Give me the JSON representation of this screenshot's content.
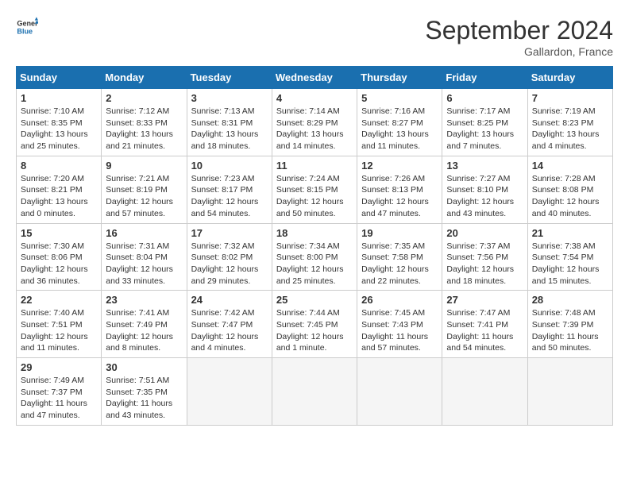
{
  "header": {
    "logo_line1": "General",
    "logo_line2": "Blue",
    "title": "September 2024",
    "location": "Gallardon, France"
  },
  "days_of_week": [
    "Sunday",
    "Monday",
    "Tuesday",
    "Wednesday",
    "Thursday",
    "Friday",
    "Saturday"
  ],
  "weeks": [
    [
      {
        "day": "1",
        "sunrise": "Sunrise: 7:10 AM",
        "sunset": "Sunset: 8:35 PM",
        "daylight": "Daylight: 13 hours and 25 minutes."
      },
      {
        "day": "2",
        "sunrise": "Sunrise: 7:12 AM",
        "sunset": "Sunset: 8:33 PM",
        "daylight": "Daylight: 13 hours and 21 minutes."
      },
      {
        "day": "3",
        "sunrise": "Sunrise: 7:13 AM",
        "sunset": "Sunset: 8:31 PM",
        "daylight": "Daylight: 13 hours and 18 minutes."
      },
      {
        "day": "4",
        "sunrise": "Sunrise: 7:14 AM",
        "sunset": "Sunset: 8:29 PM",
        "daylight": "Daylight: 13 hours and 14 minutes."
      },
      {
        "day": "5",
        "sunrise": "Sunrise: 7:16 AM",
        "sunset": "Sunset: 8:27 PM",
        "daylight": "Daylight: 13 hours and 11 minutes."
      },
      {
        "day": "6",
        "sunrise": "Sunrise: 7:17 AM",
        "sunset": "Sunset: 8:25 PM",
        "daylight": "Daylight: 13 hours and 7 minutes."
      },
      {
        "day": "7",
        "sunrise": "Sunrise: 7:19 AM",
        "sunset": "Sunset: 8:23 PM",
        "daylight": "Daylight: 13 hours and 4 minutes."
      }
    ],
    [
      {
        "day": "8",
        "sunrise": "Sunrise: 7:20 AM",
        "sunset": "Sunset: 8:21 PM",
        "daylight": "Daylight: 13 hours and 0 minutes."
      },
      {
        "day": "9",
        "sunrise": "Sunrise: 7:21 AM",
        "sunset": "Sunset: 8:19 PM",
        "daylight": "Daylight: 12 hours and 57 minutes."
      },
      {
        "day": "10",
        "sunrise": "Sunrise: 7:23 AM",
        "sunset": "Sunset: 8:17 PM",
        "daylight": "Daylight: 12 hours and 54 minutes."
      },
      {
        "day": "11",
        "sunrise": "Sunrise: 7:24 AM",
        "sunset": "Sunset: 8:15 PM",
        "daylight": "Daylight: 12 hours and 50 minutes."
      },
      {
        "day": "12",
        "sunrise": "Sunrise: 7:26 AM",
        "sunset": "Sunset: 8:13 PM",
        "daylight": "Daylight: 12 hours and 47 minutes."
      },
      {
        "day": "13",
        "sunrise": "Sunrise: 7:27 AM",
        "sunset": "Sunset: 8:10 PM",
        "daylight": "Daylight: 12 hours and 43 minutes."
      },
      {
        "day": "14",
        "sunrise": "Sunrise: 7:28 AM",
        "sunset": "Sunset: 8:08 PM",
        "daylight": "Daylight: 12 hours and 40 minutes."
      }
    ],
    [
      {
        "day": "15",
        "sunrise": "Sunrise: 7:30 AM",
        "sunset": "Sunset: 8:06 PM",
        "daylight": "Daylight: 12 hours and 36 minutes."
      },
      {
        "day": "16",
        "sunrise": "Sunrise: 7:31 AM",
        "sunset": "Sunset: 8:04 PM",
        "daylight": "Daylight: 12 hours and 33 minutes."
      },
      {
        "day": "17",
        "sunrise": "Sunrise: 7:32 AM",
        "sunset": "Sunset: 8:02 PM",
        "daylight": "Daylight: 12 hours and 29 minutes."
      },
      {
        "day": "18",
        "sunrise": "Sunrise: 7:34 AM",
        "sunset": "Sunset: 8:00 PM",
        "daylight": "Daylight: 12 hours and 25 minutes."
      },
      {
        "day": "19",
        "sunrise": "Sunrise: 7:35 AM",
        "sunset": "Sunset: 7:58 PM",
        "daylight": "Daylight: 12 hours and 22 minutes."
      },
      {
        "day": "20",
        "sunrise": "Sunrise: 7:37 AM",
        "sunset": "Sunset: 7:56 PM",
        "daylight": "Daylight: 12 hours and 18 minutes."
      },
      {
        "day": "21",
        "sunrise": "Sunrise: 7:38 AM",
        "sunset": "Sunset: 7:54 PM",
        "daylight": "Daylight: 12 hours and 15 minutes."
      }
    ],
    [
      {
        "day": "22",
        "sunrise": "Sunrise: 7:40 AM",
        "sunset": "Sunset: 7:51 PM",
        "daylight": "Daylight: 12 hours and 11 minutes."
      },
      {
        "day": "23",
        "sunrise": "Sunrise: 7:41 AM",
        "sunset": "Sunset: 7:49 PM",
        "daylight": "Daylight: 12 hours and 8 minutes."
      },
      {
        "day": "24",
        "sunrise": "Sunrise: 7:42 AM",
        "sunset": "Sunset: 7:47 PM",
        "daylight": "Daylight: 12 hours and 4 minutes."
      },
      {
        "day": "25",
        "sunrise": "Sunrise: 7:44 AM",
        "sunset": "Sunset: 7:45 PM",
        "daylight": "Daylight: 12 hours and 1 minute."
      },
      {
        "day": "26",
        "sunrise": "Sunrise: 7:45 AM",
        "sunset": "Sunset: 7:43 PM",
        "daylight": "Daylight: 11 hours and 57 minutes."
      },
      {
        "day": "27",
        "sunrise": "Sunrise: 7:47 AM",
        "sunset": "Sunset: 7:41 PM",
        "daylight": "Daylight: 11 hours and 54 minutes."
      },
      {
        "day": "28",
        "sunrise": "Sunrise: 7:48 AM",
        "sunset": "Sunset: 7:39 PM",
        "daylight": "Daylight: 11 hours and 50 minutes."
      }
    ],
    [
      {
        "day": "29",
        "sunrise": "Sunrise: 7:49 AM",
        "sunset": "Sunset: 7:37 PM",
        "daylight": "Daylight: 11 hours and 47 minutes."
      },
      {
        "day": "30",
        "sunrise": "Sunrise: 7:51 AM",
        "sunset": "Sunset: 7:35 PM",
        "daylight": "Daylight: 11 hours and 43 minutes."
      },
      {
        "day": "",
        "sunrise": "",
        "sunset": "",
        "daylight": ""
      },
      {
        "day": "",
        "sunrise": "",
        "sunset": "",
        "daylight": ""
      },
      {
        "day": "",
        "sunrise": "",
        "sunset": "",
        "daylight": ""
      },
      {
        "day": "",
        "sunrise": "",
        "sunset": "",
        "daylight": ""
      },
      {
        "day": "",
        "sunrise": "",
        "sunset": "",
        "daylight": ""
      }
    ]
  ]
}
